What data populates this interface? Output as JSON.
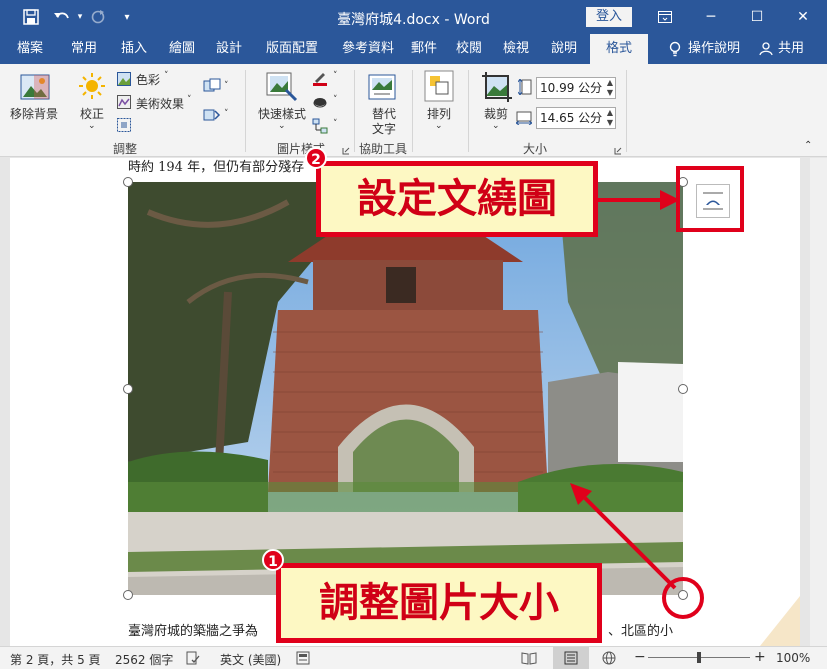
{
  "titlebar": {
    "save_icon": "save-icon",
    "undo_icon": "undo-icon",
    "redo_icon": "redo-icon",
    "customize_icon": "qat-dropdown-icon",
    "title": "臺灣府城4.docx - Word",
    "login": "登入",
    "ribbon_display_icon": "ribbon-display-icon",
    "minimize": "─",
    "maximize": "☐",
    "close": "✕"
  },
  "tabs": [
    "檔案",
    "常用",
    "插入",
    "繪圖",
    "設計",
    "版面配置",
    "參考資料",
    "郵件",
    "校閱",
    "檢視",
    "說明",
    "格式"
  ],
  "active_tab": "格式",
  "tell_me": "操作說明",
  "share": "共用",
  "ribbon": {
    "remove_bg": "移除背景",
    "corrections": "校正",
    "color": "色彩",
    "artistic": "美術效果",
    "adjust_group": "調整",
    "quick_styles": "快速樣式",
    "picture_styles_group": "圖片樣式",
    "alt_text_line1": "替代",
    "alt_text_line2": "文字",
    "accessibility_group": "協助工具",
    "arrange": "排列",
    "crop": "裁剪",
    "height": "10.99 公分",
    "width": "14.65 公分",
    "size_group": "大小"
  },
  "document": {
    "line_top": "時約 194 年，但仍有部分殘存",
    "line_bottom_left": "臺灣府城的築牆之爭為",
    "line_bottom_right": "、北區的小"
  },
  "callouts": {
    "wrap_badge": "2",
    "wrap_label": "設定文繞圖",
    "resize_badge": "1",
    "resize_label": "調整圖片大小"
  },
  "status": {
    "page": "第 2 頁，共 5 頁",
    "words": "2562 個字",
    "language": "英文 (美國)",
    "zoom": "100%",
    "zoom_minus": "−",
    "zoom_plus": "+"
  },
  "colors": {
    "word_blue": "#2b579a",
    "annotation_red": "#e0001b",
    "callout_fill": "#fdf8c3"
  }
}
